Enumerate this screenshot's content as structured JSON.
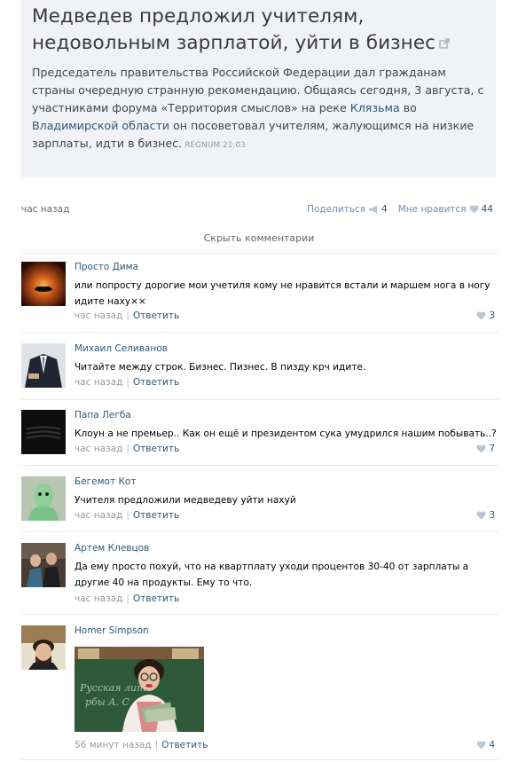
{
  "post": {
    "title": "Медведев предложил учителям, недовольным зарплатой, уйти в бизнес",
    "text_1": "Председатель правительства Российской Федерации дал гражданам страны очередную странную рекомендацию. Общаясь сегодня, 3 августа, с участниками форума «Территория смыслов» на реке ",
    "link_1": "Клязьма",
    "text_2": " во ",
    "link_2": "Владимирской области",
    "text_3": " он посоветовал учителям, жалующимся на низкие зарплаты, идти в бизнес.",
    "source": "REGNUM",
    "source_time": "21:03",
    "time": "час назад",
    "share_label": "Поделиться",
    "share_count": "4",
    "like_label": "Мне нравится",
    "like_count": "44"
  },
  "hide_comments": "Скрыть комментарии",
  "comments": [
    {
      "author": "Просто Дима",
      "text": "или попросту дорогие мои учетиля кому не нравится встали и маршем нога в ногу идите наху××",
      "time": "час назад",
      "reply": "Ответить",
      "likes": "3"
    },
    {
      "author": "Михаил Селиванов",
      "text": "Читайте между строк. Бизнес. Пизнес. В пизду крч идите.",
      "time": "час назад",
      "reply": "Ответить",
      "likes": ""
    },
    {
      "author": "Папа Легба",
      "text": "Клоун а не премьер.. Как он ещё и президентом сука умудрился нашим побывать..?",
      "time": "час назад",
      "reply": "Ответить",
      "likes": "7"
    },
    {
      "author": "Бегемот Кот",
      "text": "Учителя предложили медведеву уйти нахуй",
      "time": "час назад",
      "reply": "Ответить",
      "likes": "3"
    },
    {
      "author": "Артем Клевцов",
      "text": "Да ему просто похуй, что на квартплату уходи процентов 30-40 от зарплаты а другие 40 на продукты. Ему то что.",
      "time": "час назад",
      "reply": "Ответить",
      "likes": ""
    },
    {
      "author": "Homer Simpson",
      "text": "",
      "time": "56 минут назад",
      "reply": "Ответить",
      "likes": "4"
    }
  ],
  "icons": {
    "external_link": "external-link-icon",
    "share": "megaphone-icon",
    "like": "heart-icon"
  },
  "colors": {
    "link": "#2b587a",
    "post_bg": "#f0f2f5",
    "like_icon": "#b7c7d8"
  }
}
